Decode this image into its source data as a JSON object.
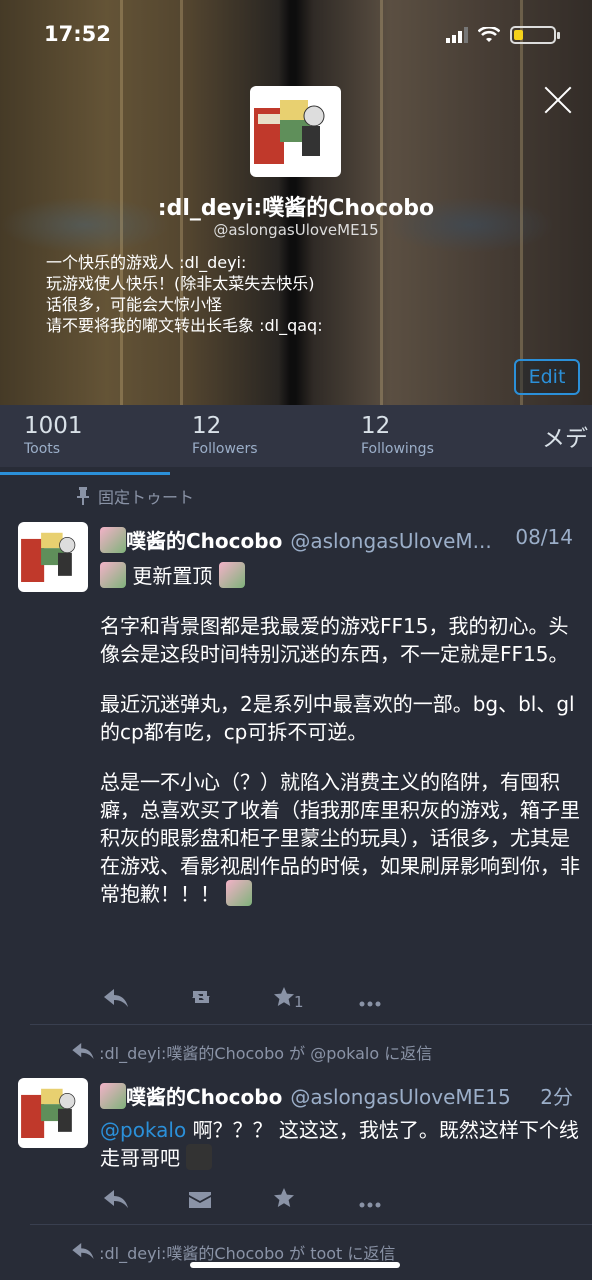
{
  "status": {
    "time": "17:52"
  },
  "profile": {
    "display_name": ":dl_deyi:噗酱的Chocobo",
    "handle": "@aslongasUloveME15",
    "bio": [
      "一个快乐的游戏人  :dl_deyi:",
      "玩游戏使人快乐！(除非太菜失去快乐)",
      "话很多，可能会大惊小怪",
      "请不要将我的嘟文转出长毛象 :dl_qaq:"
    ],
    "edit_label": "Edit"
  },
  "counts": [
    {
      "num": "1001",
      "label": "Toots"
    },
    {
      "num": "12",
      "label": "Followers"
    },
    {
      "num": "12",
      "label": "Followings"
    }
  ],
  "counts_more": "メデ",
  "pinned_label": "固定トゥート",
  "posts": [
    {
      "name": "噗酱的Chocobo",
      "acct": "@aslongasUloveM...",
      "date": "08/14",
      "first_line": "更新置顶",
      "paragraphs": [
        "名字和背景图都是我最爱的游戏FF15，我的初心。头像会是这段时间特别沉迷的东西，不一定就是FF15。",
        "最近沉迷弹丸，2是系列中最喜欢的一部。bg、bl、gl的cp都有吃，cp可拆不可逆。",
        "总是一不小心（？）就陷入消费主义的陷阱，有囤积癖，总喜欢买了收着（指我那库里积灰的游戏，箱子里积灰的眼影盘和柜子里蒙尘的玩具），话很多，尤其是在游戏、看影视剧作品的时候，如果刷屏影响到你，非常抱歉！！！"
      ],
      "fav_count": "1"
    },
    {
      "reply_label": ":dl_deyi:噗酱的Chocobo が @pokalo に返信",
      "name": "噗酱的Chocobo",
      "acct": "@aslongasUloveME15",
      "date": "2分",
      "mention": "@pokalo",
      "text": " 啊？？？ 这这这，我怯了。既然这样下个线走哥哥吧"
    }
  ],
  "reply_label_3": ":dl_deyi:噗酱的Chocobo が toot に返信",
  "colors": {
    "accent": "#2b90d9",
    "background": "#282c37",
    "muted": "#8a93a6"
  }
}
